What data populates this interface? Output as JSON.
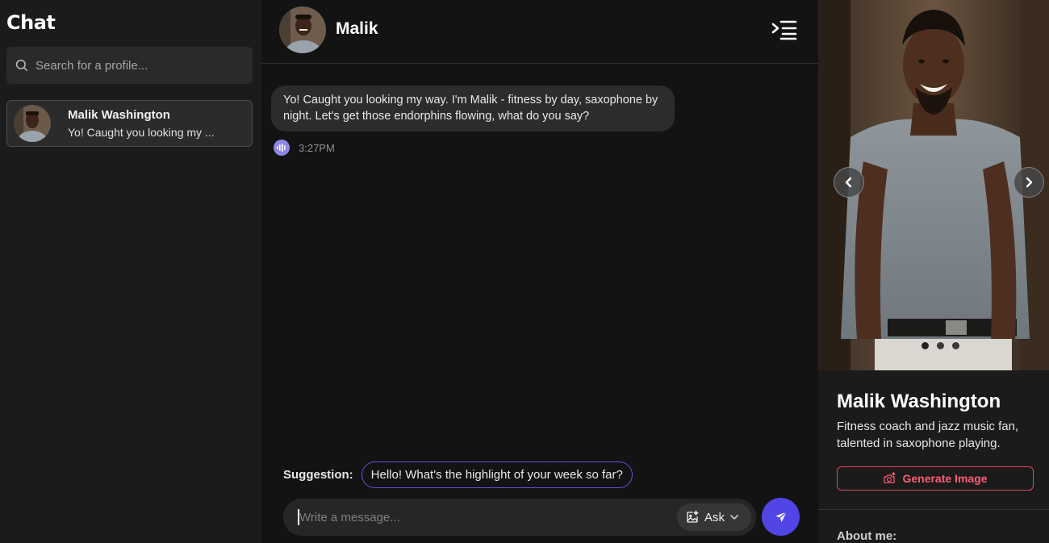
{
  "sidebar": {
    "title": "Chat",
    "search_placeholder": "Search for a profile...",
    "contacts": [
      {
        "name": "Malik Washington",
        "preview": "Yo! Caught you looking my ..."
      }
    ]
  },
  "chat": {
    "header_name": "Malik",
    "messages": [
      {
        "text": "Yo! Caught you looking my way. I'm Malik - fitness by day, saxophone by night. Let's get those endorphins flowing, what do you say?",
        "time": "3:27PM"
      }
    ],
    "suggestion_label": "Suggestion:",
    "suggestion_text": "Hello! What's the highlight of your week so far?",
    "composer_placeholder": "Write a message...",
    "ask_label": "Ask"
  },
  "profile": {
    "name": "Malik Washington",
    "bio": "Fitness coach and jazz music fan, talented in saxophone playing.",
    "generate_label": "Generate Image",
    "about_label": "About me:",
    "photo_count": 3,
    "active_photo": 1
  },
  "colors": {
    "accent": "#5145e5",
    "chip_border": "#5b56d6",
    "generate": "#ff5c76",
    "voice": "#8e86e8"
  }
}
